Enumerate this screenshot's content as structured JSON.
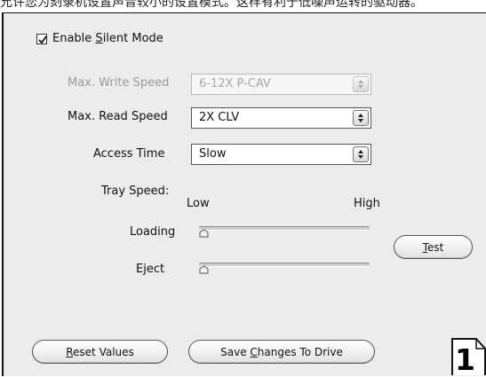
{
  "header_text": "允许您为刻录机设置声音较小的设置模式。这样有利于低噪声运转的驱动器。",
  "silent_mode": {
    "label_pre": "Enable ",
    "label_acc": "S",
    "label_post": "ilent Mode",
    "checked": true
  },
  "write_speed": {
    "label": "Max. Write Speed",
    "value": "6-12X P-CAV",
    "enabled": false
  },
  "read_speed": {
    "label": "Max. Read Speed",
    "value": "2X CLV"
  },
  "access_time": {
    "label": "Access Time",
    "value": "Slow"
  },
  "tray_speed": {
    "label": "Tray Speed:",
    "low_label": "Low",
    "high_label": "High",
    "loading": {
      "label": "Loading",
      "level": 0.0
    },
    "eject": {
      "label": "Eject",
      "level": 0.0
    }
  },
  "buttons": {
    "test": {
      "acc": "T",
      "rest": "est"
    },
    "reset": {
      "acc": "R",
      "rest": "eset Values"
    },
    "save": {
      "pre": "Save ",
      "acc": "C",
      "rest": "hanges To Drive"
    }
  },
  "page_badge": "1",
  "colors": {
    "panel_bg": "#ececec",
    "disabled_text": "#9a9a9a"
  }
}
